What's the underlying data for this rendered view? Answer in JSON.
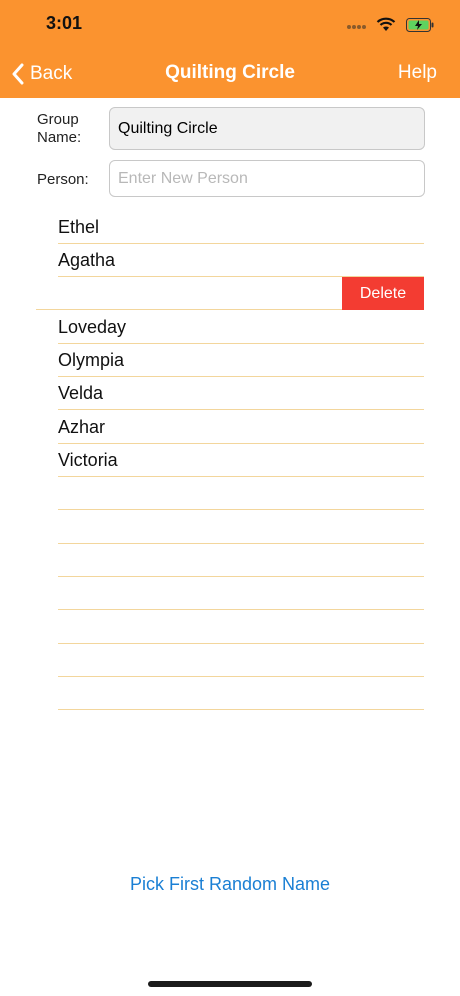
{
  "status_bar": {
    "time": "3:01"
  },
  "nav": {
    "back_label": "Back",
    "title": "Quilting Circle",
    "help_label": "Help"
  },
  "form": {
    "group_label": "Group\nName:",
    "group_value": "Quilting Circle",
    "person_label": "Person:",
    "person_placeholder": "Enter New Person"
  },
  "people": [
    {
      "name": "Ethel"
    },
    {
      "name": "Agatha"
    },
    {
      "name": ""
    },
    {
      "name": "Loveday"
    },
    {
      "name": "Olympia"
    },
    {
      "name": "Velda"
    },
    {
      "name": "Azhar"
    },
    {
      "name": "Victoria"
    },
    {
      "name": ""
    },
    {
      "name": ""
    },
    {
      "name": ""
    },
    {
      "name": ""
    },
    {
      "name": ""
    },
    {
      "name": ""
    },
    {
      "name": ""
    }
  ],
  "delete_label": "Delete",
  "pick_label": "Pick First Random Name",
  "colors": {
    "accent": "#fb932f",
    "delete": "#f33c32",
    "link": "#1a7fd4",
    "separator": "#f3d69c"
  }
}
